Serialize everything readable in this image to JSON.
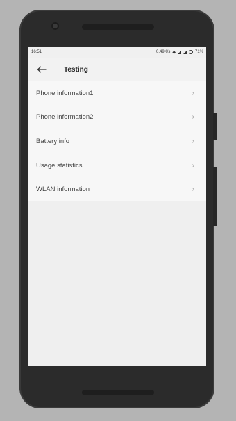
{
  "status_bar": {
    "time": "16:51",
    "network_speed": "0.49K/s",
    "battery": "71%"
  },
  "toolbar": {
    "title": "Testing",
    "back_icon": "arrow-left-icon"
  },
  "menu": {
    "items": [
      {
        "label": "Phone information1"
      },
      {
        "label": "Phone information2"
      },
      {
        "label": "Battery info"
      },
      {
        "label": "Usage statistics"
      },
      {
        "label": "WLAN information"
      }
    ]
  },
  "colors": {
    "background": "#b4b4b4",
    "phone_body": "#2b2b2b",
    "screen": "#efefef",
    "text": "#444444"
  }
}
